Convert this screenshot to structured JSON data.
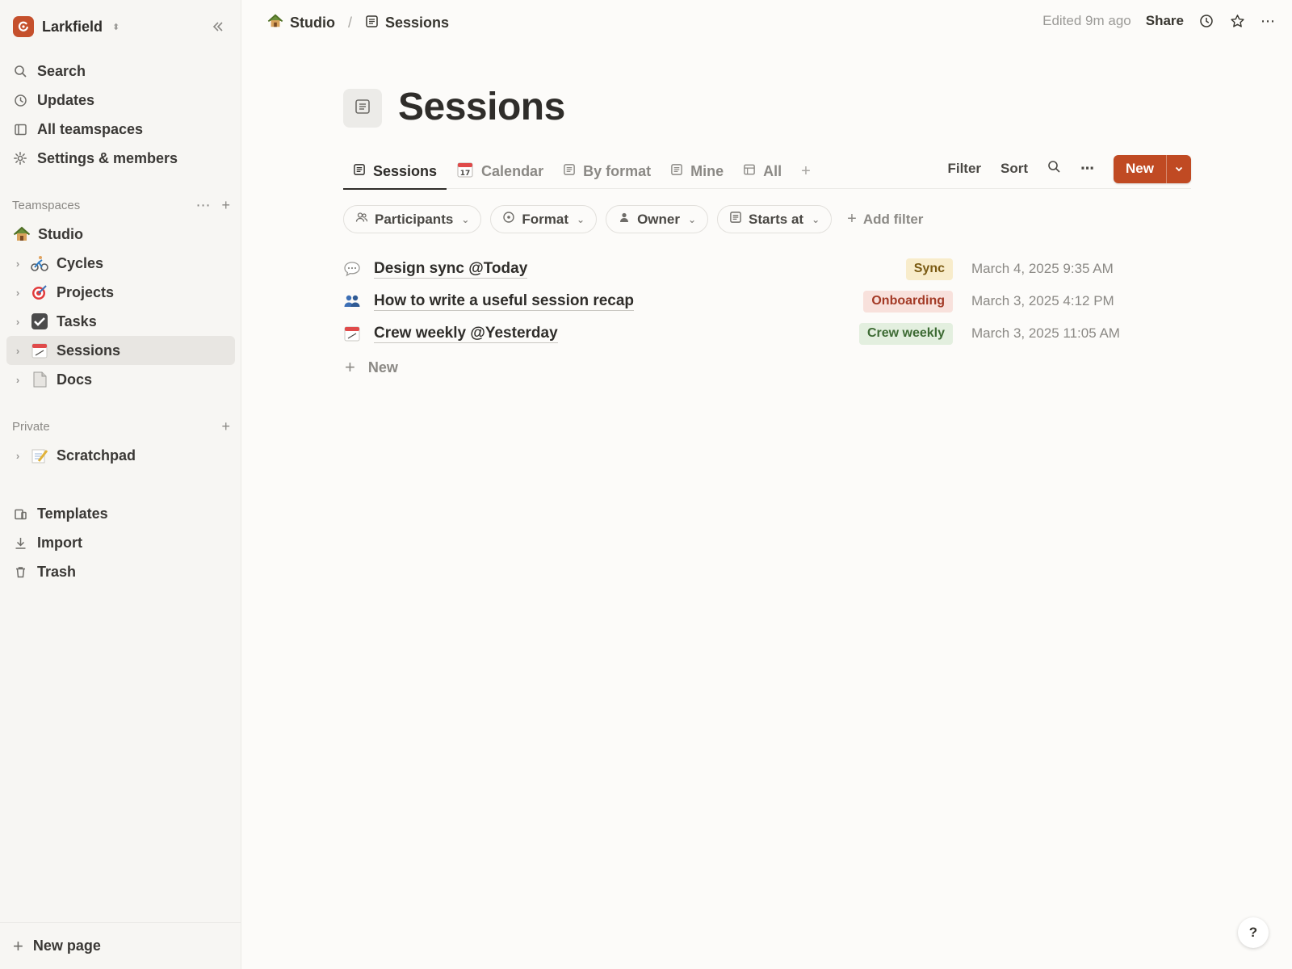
{
  "workspace": {
    "name": "Larkfield",
    "brand_color": "#c5502c"
  },
  "sidebar": {
    "nav": [
      {
        "label": "Search",
        "icon": "search-icon"
      },
      {
        "label": "Updates",
        "icon": "clock-icon"
      },
      {
        "label": "All teamspaces",
        "icon": "teamspaces-icon"
      },
      {
        "label": "Settings & members",
        "icon": "gear-icon"
      }
    ],
    "teamspaces_label": "Teamspaces",
    "teamspace_root": {
      "label": "Studio",
      "icon": "house-icon"
    },
    "tree": [
      {
        "label": "Cycles",
        "icon": "cyclist-icon"
      },
      {
        "label": "Projects",
        "icon": "target-icon"
      },
      {
        "label": "Tasks",
        "icon": "checkbox-icon"
      },
      {
        "label": "Sessions",
        "icon": "calendar-icon",
        "active": true
      },
      {
        "label": "Docs",
        "icon": "document-icon"
      }
    ],
    "private_label": "Private",
    "private_tree": [
      {
        "label": "Scratchpad",
        "icon": "memo-icon"
      }
    ],
    "bottom": [
      {
        "label": "Templates",
        "icon": "templates-icon"
      },
      {
        "label": "Import",
        "icon": "download-icon"
      },
      {
        "label": "Trash",
        "icon": "trash-icon"
      }
    ],
    "new_page": "New page"
  },
  "topbar": {
    "crumbs": [
      {
        "label": "Studio"
      },
      {
        "label": "Sessions"
      }
    ],
    "separator": "/",
    "edited": "Edited 9m ago",
    "share": "Share"
  },
  "page": {
    "title": "Sessions",
    "tabs": [
      {
        "label": "Sessions",
        "icon": "list-icon",
        "active": true
      },
      {
        "label": "Calendar",
        "icon": "calendar-icon"
      },
      {
        "label": "By format",
        "icon": "list-icon"
      },
      {
        "label": "Mine",
        "icon": "list-icon"
      },
      {
        "label": "All",
        "icon": "table-icon"
      }
    ],
    "actions": {
      "filter": "Filter",
      "sort": "Sort",
      "new": "New"
    },
    "accent_color": "#c04a23",
    "filters": [
      {
        "label": "Participants",
        "icon": "people-icon"
      },
      {
        "label": "Format",
        "icon": "status-icon"
      },
      {
        "label": "Owner",
        "icon": "person-icon"
      },
      {
        "label": "Starts at",
        "icon": "list-icon"
      }
    ],
    "add_filter": "Add filter",
    "rows": [
      {
        "title": "Design sync @Today",
        "icon": "speech-bubble-icon",
        "tag": "Sync",
        "tag_bg": "#f8eccb",
        "tag_fg": "#7a5a12",
        "date": "March 4, 2025 9:35 AM"
      },
      {
        "title": "How to write a useful session recap",
        "icon": "people-icon",
        "tag": "Onboarding",
        "tag_bg": "#f8e1dc",
        "tag_fg": "#a33a26",
        "date": "March 3, 2025 4:12 PM"
      },
      {
        "title": "Crew weekly @Yesterday",
        "icon": "calendar-icon",
        "tag": "Crew weekly",
        "tag_bg": "#e3efdf",
        "tag_fg": "#3d6b34",
        "date": "March 3, 2025 11:05 AM"
      }
    ],
    "new_row": "New"
  },
  "help": "?"
}
